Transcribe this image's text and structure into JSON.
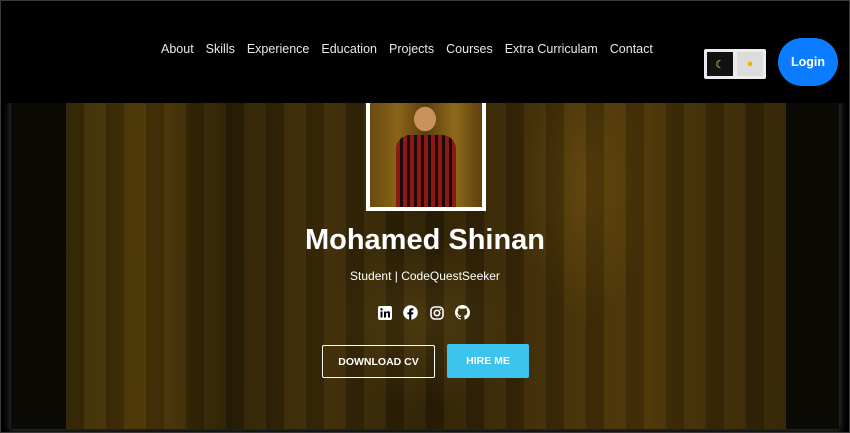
{
  "nav": {
    "links": [
      "About",
      "Skills",
      "Experience",
      "Education",
      "Projects",
      "Courses",
      "Extra Curriculam",
      "Contact"
    ],
    "login_label": "Login",
    "theme_toggle": {
      "dark_icon": "moon-icon",
      "light_icon": "sun-icon"
    }
  },
  "hero": {
    "name": "Mohamed Shinan",
    "subtitle": "Student | CodeQuestSeeker",
    "socials": [
      "linkedin-icon",
      "facebook-icon",
      "instagram-icon",
      "github-icon"
    ],
    "download_label": "DOWNLOAD CV",
    "hire_label": "HIRE ME"
  },
  "colors": {
    "accent": "#0b7cff",
    "hire": "#3cc3ee",
    "background": "#000000"
  }
}
